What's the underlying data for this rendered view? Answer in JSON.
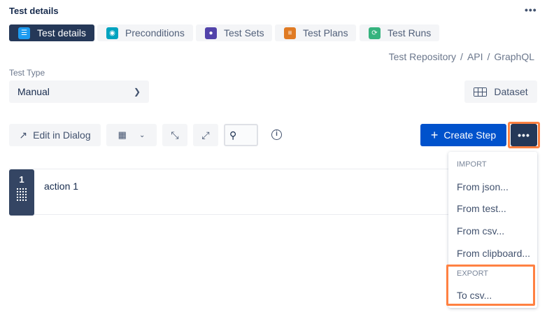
{
  "header": {
    "title": "Test details",
    "more": "•••"
  },
  "tabs": [
    {
      "label": "Test details",
      "icon": "list-icon",
      "color": "#1d9bf0"
    },
    {
      "label": "Preconditions",
      "icon": "precondition-icon",
      "color": "#00a3bf"
    },
    {
      "label": "Test Sets",
      "icon": "test-sets-icon",
      "color": "#5243aa"
    },
    {
      "label": "Test Plans",
      "icon": "test-plans-icon",
      "color": "#e07b24"
    },
    {
      "label": "Test Runs",
      "icon": "test-runs-icon",
      "color": "#36b37e"
    }
  ],
  "breadcrumb": [
    "Test Repository",
    "API",
    "GraphQL"
  ],
  "test_type": {
    "label": "Test Type",
    "value": "Manual"
  },
  "dataset_label": "Dataset",
  "toolbar": {
    "edit_dialog": "Edit in Dialog",
    "create_step": "Create Step",
    "more": "•••"
  },
  "steps": [
    {
      "number": "1",
      "action": "action 1"
    }
  ],
  "menu": {
    "import_header": "IMPORT",
    "items": [
      "From json...",
      "From test...",
      "From csv...",
      "From clipboard..."
    ],
    "export_header": "EXPORT",
    "export_items": [
      "To csv..."
    ]
  },
  "colors": {
    "primary": "#0052cc",
    "dark": "#253858",
    "highlight": "#ff8142"
  }
}
